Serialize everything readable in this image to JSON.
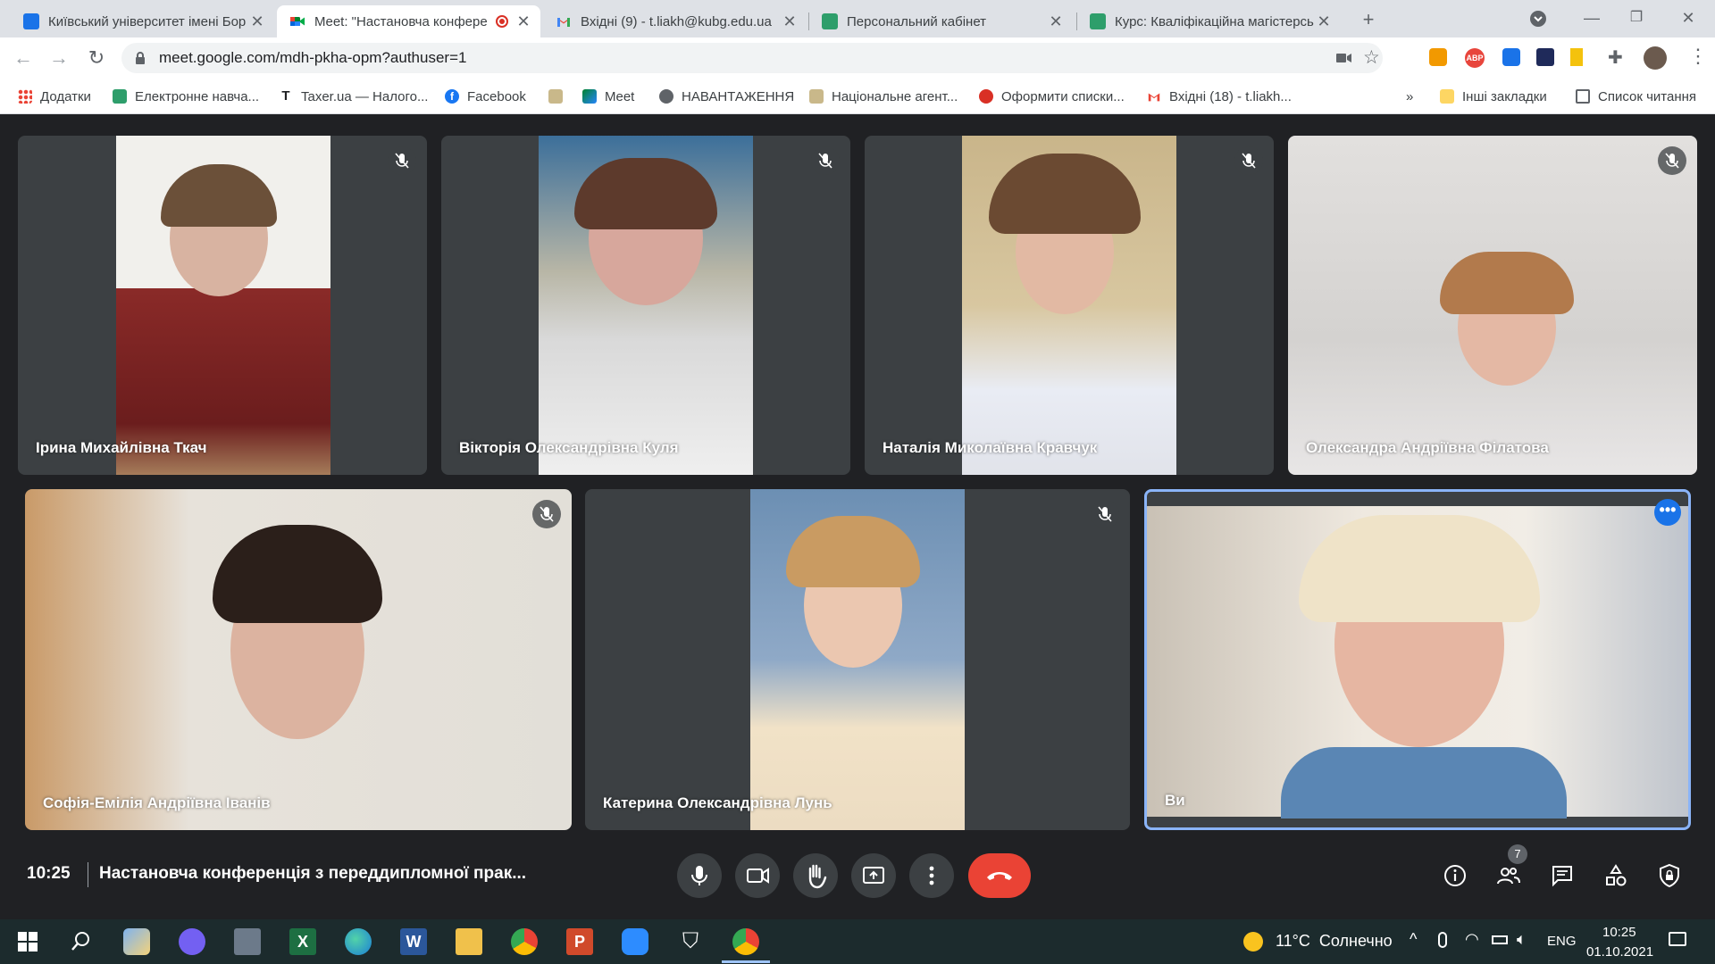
{
  "tabs": [
    {
      "title": "Київський університет імені Бор",
      "active": false
    },
    {
      "title": "Meet: \"Настановча конфере",
      "active": true
    },
    {
      "title": "Вхідні (9) - t.liakh@kubg.edu.ua",
      "active": false
    },
    {
      "title": "Персональний кабінет",
      "active": false
    },
    {
      "title": "Курс: Кваліфікаційна магістерсь",
      "active": false
    }
  ],
  "address": {
    "url": "meet.google.com/mdh-pkha-opm?authuser=1"
  },
  "bookmarks": {
    "items": [
      "Додатки",
      "Електронне навча...",
      "Taxer.ua — Налого...",
      "Facebook",
      "",
      "Meet",
      "НАВАНТАЖЕННЯ",
      "Національне агент...",
      "Оформити списки...",
      "Вхідні (18) - t.liakh..."
    ],
    "overflow": "»",
    "other": "Інші закладки",
    "reading_list": "Список читання"
  },
  "participants": [
    {
      "name": "Ірина Михайлівна Ткач",
      "muted": true
    },
    {
      "name": "Вікторія Олександрівна Куля",
      "muted": true
    },
    {
      "name": "Наталія Миколаївна Кравчук",
      "muted": true
    },
    {
      "name": "Олександра Андріївна Філатова",
      "muted": true
    },
    {
      "name": "Софія-Емілія Андріївна Іванів",
      "muted": true
    },
    {
      "name": "Катерина Олександрівна Лунь",
      "muted": true
    },
    {
      "name": "Ви",
      "muted": false
    }
  ],
  "meeting": {
    "time": "10:25",
    "title": "Настановча конференція з переддипломної прак...",
    "participants_count": "7"
  },
  "taskbar": {
    "weather": "11°C  Солнечно",
    "lang": "ENG",
    "time": "10:25",
    "date": "01.10.2021"
  },
  "colors": {
    "meet_bg": "#202124",
    "tile_bg": "#3c4043",
    "end_call": "#ea4335",
    "active_speaker": "#8ab4f8"
  }
}
